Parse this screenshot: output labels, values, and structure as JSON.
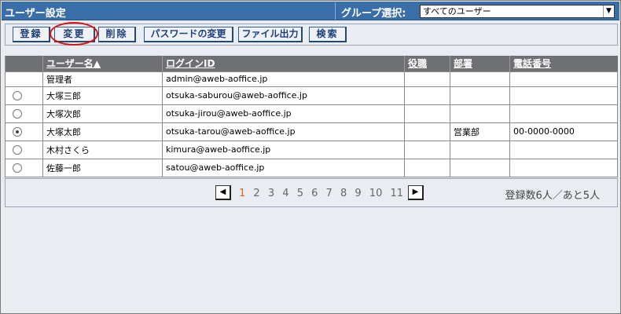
{
  "header": {
    "title": "ユーザー設定",
    "group_label": "グループ選択:",
    "group_selected": "すべてのユーザー"
  },
  "toolbar": {
    "register": "登録",
    "change": "変更",
    "delete": "削除",
    "password_change": "パスワードの変更",
    "file_output": "ファイル出力",
    "search": "検索"
  },
  "table": {
    "columns": [
      "",
      "ユーザー名▲",
      "ログインID",
      "役職",
      "部署",
      "電話番号"
    ],
    "rows": [
      {
        "name": "管理者",
        "login": "admin@aweb-aoffice.jp",
        "role": "",
        "dept": "",
        "phone": ""
      },
      {
        "name": "大塚三郎",
        "login": "otsuka-saburou@aweb-aoffice.jp",
        "role": "",
        "dept": "",
        "phone": ""
      },
      {
        "name": "大塚次郎",
        "login": "otsuka-jirou@aweb-aoffice.jp",
        "role": "",
        "dept": "",
        "phone": ""
      },
      {
        "name": "大塚太郎",
        "login": "otsuka-tarou@aweb-aoffice.jp",
        "role": "",
        "dept": "営業部",
        "phone": "00-0000-0000"
      },
      {
        "name": "木村さくら",
        "login": "kimura@aweb-aoffice.jp",
        "role": "",
        "dept": "",
        "phone": ""
      },
      {
        "name": "佐藤一郎",
        "login": "satou@aweb-aoffice.jp",
        "role": "",
        "dept": "",
        "phone": ""
      }
    ]
  },
  "pager": {
    "pages": [
      "1",
      "2",
      "3",
      "4",
      "5",
      "6",
      "7",
      "8",
      "9",
      "10",
      "11"
    ],
    "current": "1",
    "summary": "登録数6人／あと5人"
  },
  "colors": {
    "header_bg": "#3a6ea8",
    "table_header_bg": "#6e7073",
    "highlight": "#e01010",
    "current_page": "#e06a10"
  }
}
